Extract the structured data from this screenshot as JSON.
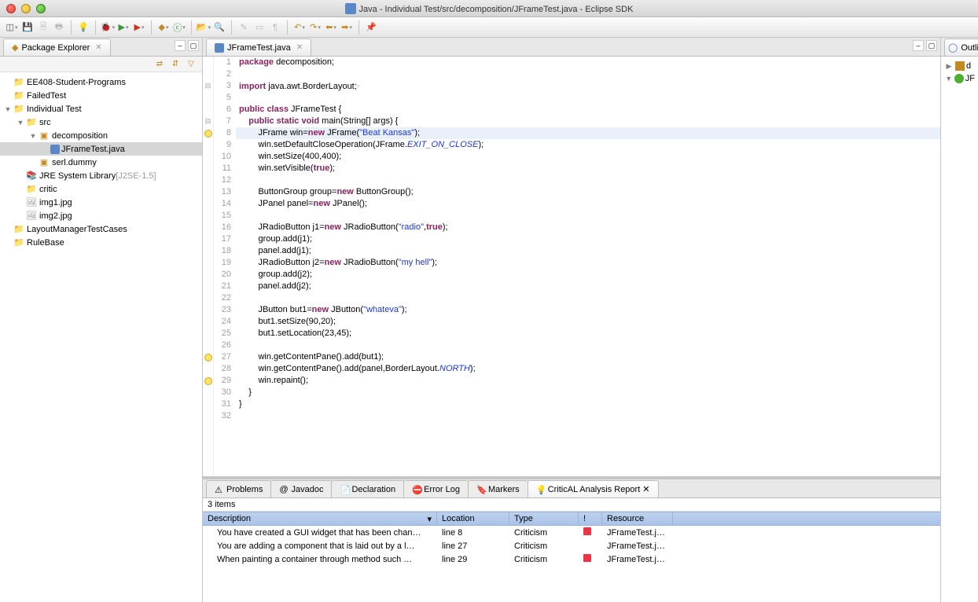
{
  "window": {
    "title": "Java - Individual Test/src/decomposition/JFrameTest.java - Eclipse SDK"
  },
  "package_explorer": {
    "title": "Package Explorer",
    "projects": [
      {
        "name": "EE408-Student-Programs",
        "expanded": false,
        "icon": "proj"
      },
      {
        "name": "FailedTest",
        "expanded": false,
        "icon": "proj"
      },
      {
        "name": "Individual Test",
        "expanded": true,
        "icon": "proj",
        "children": [
          {
            "name": "src",
            "expanded": true,
            "icon": "folder",
            "children": [
              {
                "name": "decomposition",
                "expanded": true,
                "icon": "pkg",
                "children": [
                  {
                    "name": "JFrameTest.java",
                    "icon": "java",
                    "selected": true
                  }
                ]
              },
              {
                "name": "serl.dummy",
                "expanded": false,
                "icon": "pkg"
              }
            ]
          },
          {
            "name": "JRE System Library",
            "suffix": "[J2SE-1.5]",
            "expanded": false,
            "icon": "lib"
          },
          {
            "name": "critic",
            "expanded": false,
            "icon": "folder"
          },
          {
            "name": "img1.jpg",
            "icon": "img"
          },
          {
            "name": "img2.jpg",
            "icon": "img"
          }
        ]
      },
      {
        "name": "LayoutManagerTestCases",
        "expanded": false,
        "icon": "proj"
      },
      {
        "name": "RuleBase",
        "expanded": false,
        "icon": "proj"
      }
    ]
  },
  "editor": {
    "tab_label": "JFrameTest.java",
    "highlighted_line": 8,
    "markers": {
      "3": "collapse",
      "7": "collapse",
      "8": "bulb",
      "27": "bulb",
      "29": "bulb"
    },
    "lines": [
      {
        "n": 1,
        "tokens": [
          [
            "k",
            "package"
          ],
          [
            "",
            " decomposition;"
          ]
        ]
      },
      {
        "n": 2,
        "tokens": []
      },
      {
        "n": 3,
        "tokens": [
          [
            "k",
            "import"
          ],
          [
            "",
            " java.awt.BorderLayout;"
          ],
          [
            "collapse",
            "▫"
          ]
        ]
      },
      {
        "n": 5,
        "tokens": []
      },
      {
        "n": 6,
        "tokens": [
          [
            "k",
            "public class"
          ],
          [
            "",
            " JFrameTest {"
          ]
        ]
      },
      {
        "n": 7,
        "tokens": [
          [
            "",
            "    "
          ],
          [
            "k",
            "public static void"
          ],
          [
            "",
            " main(String[] args) {"
          ]
        ]
      },
      {
        "n": 8,
        "tokens": [
          [
            "",
            "        JFrame win="
          ],
          [
            "k",
            "new"
          ],
          [
            "",
            " JFrame("
          ],
          [
            "s",
            "\"Beat Kansas\""
          ],
          [
            "",
            ");"
          ]
        ]
      },
      {
        "n": 9,
        "tokens": [
          [
            "",
            "        win.setDefaultCloseOperation(JFrame."
          ],
          [
            "f",
            "EXIT_ON_CLOSE"
          ],
          [
            "",
            ");"
          ]
        ]
      },
      {
        "n": 10,
        "tokens": [
          [
            "",
            "        win.setSize(400,400);"
          ]
        ]
      },
      {
        "n": 11,
        "tokens": [
          [
            "",
            "        win.setVisible("
          ],
          [
            "k",
            "true"
          ],
          [
            "",
            ");"
          ]
        ]
      },
      {
        "n": 12,
        "tokens": []
      },
      {
        "n": 13,
        "tokens": [
          [
            "",
            "        ButtonGroup group="
          ],
          [
            "k",
            "new"
          ],
          [
            "",
            " ButtonGroup();"
          ]
        ]
      },
      {
        "n": 14,
        "tokens": [
          [
            "",
            "        JPanel panel="
          ],
          [
            "k",
            "new"
          ],
          [
            "",
            " JPanel();"
          ]
        ]
      },
      {
        "n": 15,
        "tokens": []
      },
      {
        "n": 16,
        "tokens": [
          [
            "",
            "        JRadioButton j1="
          ],
          [
            "k",
            "new"
          ],
          [
            "",
            " JRadioButton("
          ],
          [
            "s",
            "\"radio\""
          ],
          [
            "",
            ","
          ],
          [
            "k",
            "true"
          ],
          [
            "",
            ");"
          ]
        ]
      },
      {
        "n": 17,
        "tokens": [
          [
            "",
            "        group.add(j1);"
          ]
        ]
      },
      {
        "n": 18,
        "tokens": [
          [
            "",
            "        panel.add(j1);"
          ]
        ]
      },
      {
        "n": 19,
        "tokens": [
          [
            "",
            "        JRadioButton j2="
          ],
          [
            "k",
            "new"
          ],
          [
            "",
            " JRadioButton("
          ],
          [
            "s",
            "\"my hell\""
          ],
          [
            "",
            ");"
          ]
        ]
      },
      {
        "n": 20,
        "tokens": [
          [
            "",
            "        group.add(j2);"
          ]
        ]
      },
      {
        "n": 21,
        "tokens": [
          [
            "",
            "        panel.add(j2);"
          ]
        ]
      },
      {
        "n": 22,
        "tokens": []
      },
      {
        "n": 23,
        "tokens": [
          [
            "",
            "        JButton but1="
          ],
          [
            "k",
            "new"
          ],
          [
            "",
            " JButton("
          ],
          [
            "s",
            "\"whateva\""
          ],
          [
            "",
            ");"
          ]
        ]
      },
      {
        "n": 24,
        "tokens": [
          [
            "",
            "        but1.setSize(90,20);"
          ]
        ]
      },
      {
        "n": 25,
        "tokens": [
          [
            "",
            "        but1.setLocation(23,45);"
          ]
        ]
      },
      {
        "n": 26,
        "tokens": []
      },
      {
        "n": 27,
        "tokens": [
          [
            "",
            "        win.getContentPane().add(but1);"
          ]
        ]
      },
      {
        "n": 28,
        "tokens": [
          [
            "",
            "        win.getContentPane().add(panel,BorderLayout."
          ],
          [
            "f",
            "NORTH"
          ],
          [
            "",
            ");"
          ]
        ]
      },
      {
        "n": 29,
        "tokens": [
          [
            "",
            "        win.repaint();"
          ]
        ]
      },
      {
        "n": 30,
        "tokens": [
          [
            "",
            "    }"
          ]
        ]
      },
      {
        "n": 31,
        "tokens": [
          [
            "",
            "}"
          ]
        ]
      },
      {
        "n": 32,
        "tokens": []
      }
    ]
  },
  "bottom_panel": {
    "tabs": [
      "Problems",
      "Javadoc",
      "Declaration",
      "Error Log",
      "Markers",
      "CriticAL Analysis Report"
    ],
    "active_tab": 5,
    "count_text": "3 items",
    "columns": [
      "Description",
      "Location",
      "Type",
      "!",
      "Resource"
    ],
    "rows": [
      {
        "desc": "You have created a GUI widget that has been chan…",
        "loc": "line 8",
        "type": "Criticism",
        "pri": true,
        "res": "JFrameTest.java"
      },
      {
        "desc": "You are adding a component that is laid out by a l…",
        "loc": "line 27",
        "type": "Criticism",
        "pri": false,
        "res": "JFrameTest.java"
      },
      {
        "desc": "When painting a container through method such …",
        "loc": "line 29",
        "type": "Criticism",
        "pri": true,
        "res": "JFrameTest.java"
      }
    ]
  },
  "outline": {
    "title": "Outli",
    "items": [
      "d",
      "JF"
    ]
  }
}
